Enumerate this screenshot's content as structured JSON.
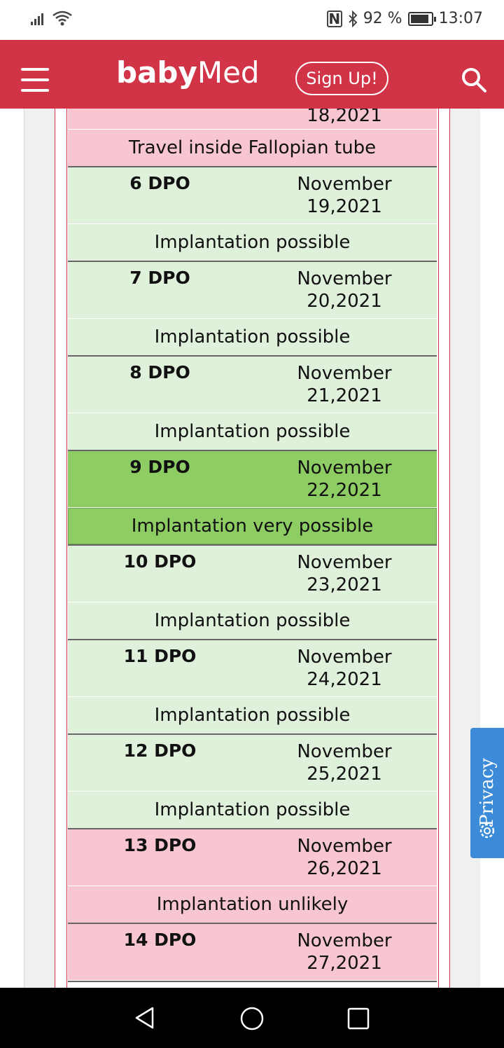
{
  "status_bar": {
    "battery_percent": "92 %",
    "time": "13:07",
    "icons": [
      "signal-icon",
      "wifi-icon",
      "nfc-icon",
      "bluetooth-icon",
      "battery-icon"
    ]
  },
  "header": {
    "logo_part1": "baby",
    "logo_part2": "Med",
    "signup_label": "Sign Up!",
    "brand_color": "#d23447"
  },
  "partial_block": {
    "date_tail": "18,2021",
    "note": "Travel inside Fallopian tube"
  },
  "rows": [
    {
      "dpo": "6 DPO",
      "month": "November",
      "day_year": "19,2021",
      "note": "Implantation possible",
      "status": "green"
    },
    {
      "dpo": "7 DPO",
      "month": "November",
      "day_year": "20,2021",
      "note": "Implantation possible",
      "status": "green"
    },
    {
      "dpo": "8 DPO",
      "month": "November",
      "day_year": "21,2021",
      "note": "Implantation possible",
      "status": "green"
    },
    {
      "dpo": "9 DPO",
      "month": "November",
      "day_year": "22,2021",
      "note": "Implantation very possible",
      "status": "bright"
    },
    {
      "dpo": "10 DPO",
      "month": "November",
      "day_year": "23,2021",
      "note": "Implantation possible",
      "status": "green"
    },
    {
      "dpo": "11 DPO",
      "month": "November",
      "day_year": "24,2021",
      "note": "Implantation possible",
      "status": "green"
    },
    {
      "dpo": "12 DPO",
      "month": "November",
      "day_year": "25,2021",
      "note": "Implantation possible",
      "status": "green"
    },
    {
      "dpo": "13 DPO",
      "month": "November",
      "day_year": "26,2021",
      "note": "Implantation unlikely",
      "status": "pink"
    },
    {
      "dpo": "14 DPO",
      "month": "November",
      "day_year": "27,2021",
      "note": "",
      "status": "pink"
    }
  ],
  "privacy": {
    "label": "Privacy",
    "color": "#3b8bd8"
  },
  "status_colors": {
    "green": "#dff0db",
    "bright": "#8ecc64",
    "pink": "#f7c6d1"
  }
}
